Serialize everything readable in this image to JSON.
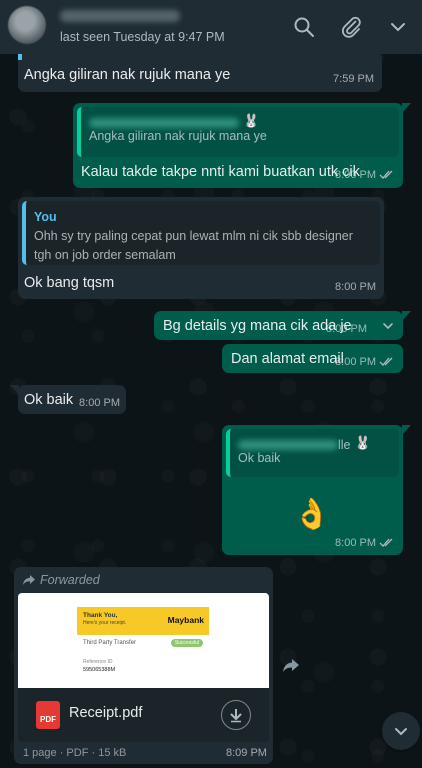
{
  "header": {
    "last_seen": "last seen Tuesday at 9:47 PM",
    "icons": [
      "search-icon",
      "paperclip-icon",
      "chevron-down-icon"
    ]
  },
  "messages": {
    "m1": {
      "text": "Angka giliran nak rujuk mana ye",
      "time": "7:59 PM"
    },
    "m2": {
      "quote_text": "Angka giliran nak rujuk mana ye",
      "quote_emoji": "🐰",
      "text": "Kalau takde takpe nnti kami buatkan utk cik",
      "time": "8:00 PM"
    },
    "m3": {
      "quote_name": "You",
      "quote_text": "Ohh sy try paling cepat pun lewat mlm ni cik sbb designer tgh on job order semalam",
      "text": "Ok bang tqsm",
      "time": "8:00 PM"
    },
    "m4": {
      "text": "Bg details yg mana cik ada je",
      "time": "8:00 PM"
    },
    "m5": {
      "text": "Dan alamat email",
      "time": "8:00 PM"
    },
    "m6": {
      "text": "Ok baik",
      "time": "8:00 PM"
    },
    "m7": {
      "quote_text": "Ok baik",
      "quote_suffix": "lle",
      "quote_emoji": "🐰",
      "emoji": "👌",
      "time": "8:00 PM"
    },
    "m8": {
      "forwarded": "Forwarded",
      "file_name": "Receipt.pdf",
      "file_badge": "PDF",
      "meta": "1 page · PDF · 15 kB",
      "time": "8:09 PM",
      "preview": {
        "thank": "Thank You,",
        "sub": "Here's your receipt.",
        "brand": "Maybank",
        "type": "Third Party Transfer",
        "status": "Successful",
        "ref_label": "Reference ID",
        "ref_value": "595065388M"
      }
    }
  },
  "colors": {
    "incoming": "#202c33",
    "outgoing": "#005c4b",
    "header": "#1f2c33",
    "accent": "#53bdeb"
  }
}
